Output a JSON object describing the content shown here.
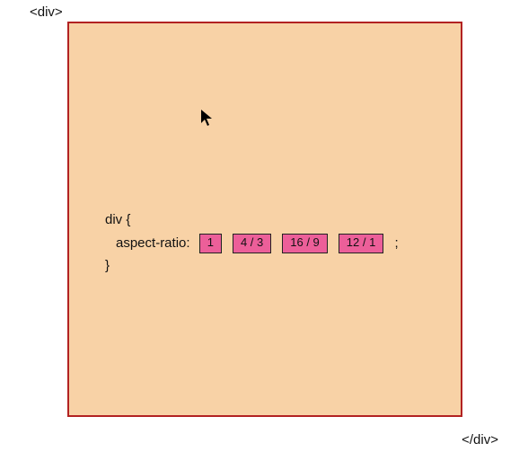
{
  "tags": {
    "open": "<div>",
    "close": "</div>"
  },
  "code": {
    "selector": "div {",
    "property_label": "aspect-ratio:",
    "semicolon": ";",
    "close_brace": "}",
    "options": [
      "1",
      "4 / 3",
      "16 / 9",
      "12 / 1"
    ]
  },
  "cursor_glyph": "➤"
}
